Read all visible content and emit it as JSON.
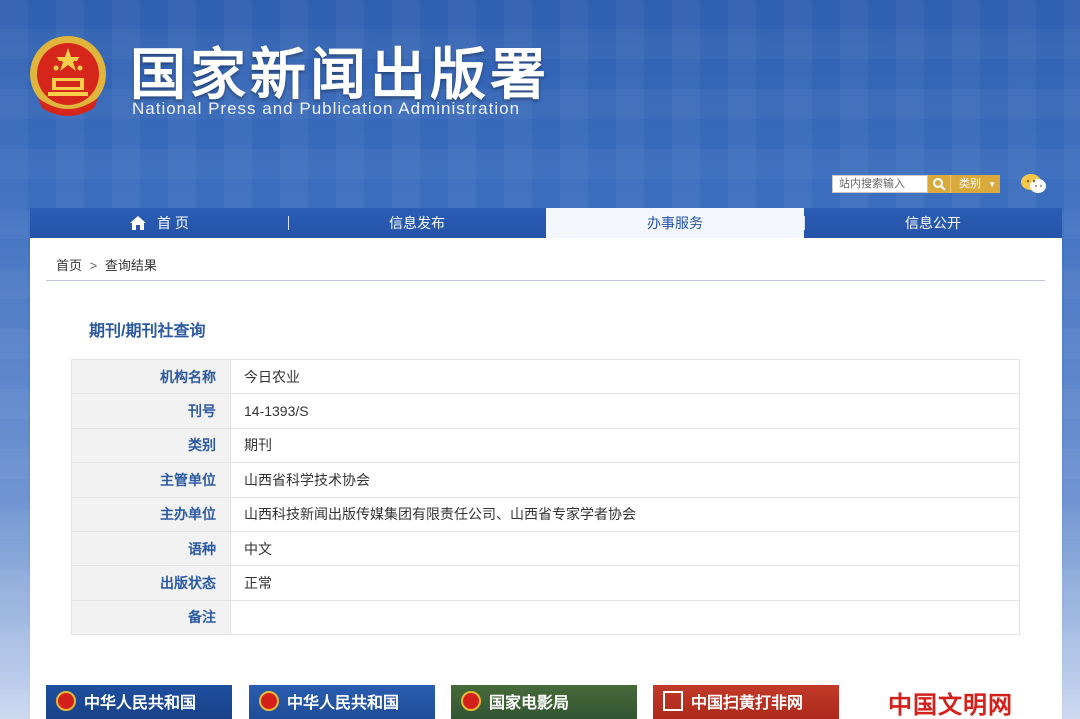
{
  "header": {
    "title": "国家新闻出版署",
    "subtitle": "National  Press and Publication Administration",
    "search": {
      "placeholder": "站内搜索输入",
      "category_label": "类别"
    }
  },
  "nav": {
    "items": [
      {
        "label": "首 页",
        "icon": "home-icon"
      },
      {
        "label": "信息发布"
      },
      {
        "label": "办事服务",
        "active": true
      },
      {
        "label": "信息公开"
      }
    ]
  },
  "breadcrumb": {
    "home": "首页",
    "separator": ">",
    "current": "查询结果"
  },
  "section": {
    "title": "期刊/期刊社查询"
  },
  "record": {
    "rows": [
      {
        "label": "机构名称",
        "value": "今日农业"
      },
      {
        "label": "刊号",
        "value": "14-1393/S"
      },
      {
        "label": "类别",
        "value": "期刊"
      },
      {
        "label": "主管单位",
        "value": "山西省科学技术协会"
      },
      {
        "label": "主办单位",
        "value": "山西科技新闻出版传媒集团有限责任公司、山西省专家学者协会"
      },
      {
        "label": "语种",
        "value": "中文"
      },
      {
        "label": "出版状态",
        "value": "正常"
      },
      {
        "label": "备注",
        "value": ""
      }
    ]
  },
  "footer_banners": [
    {
      "label": "中华人民共和国"
    },
    {
      "label": "中华人民共和国"
    },
    {
      "label": "国家电影局"
    },
    {
      "label": "中国扫黄打非网"
    },
    {
      "label": "中国文明网"
    }
  ],
  "colors": {
    "nav_bg": "#2554a8",
    "accent": "#2c5aa0",
    "search_btn": "#d9a93b"
  }
}
